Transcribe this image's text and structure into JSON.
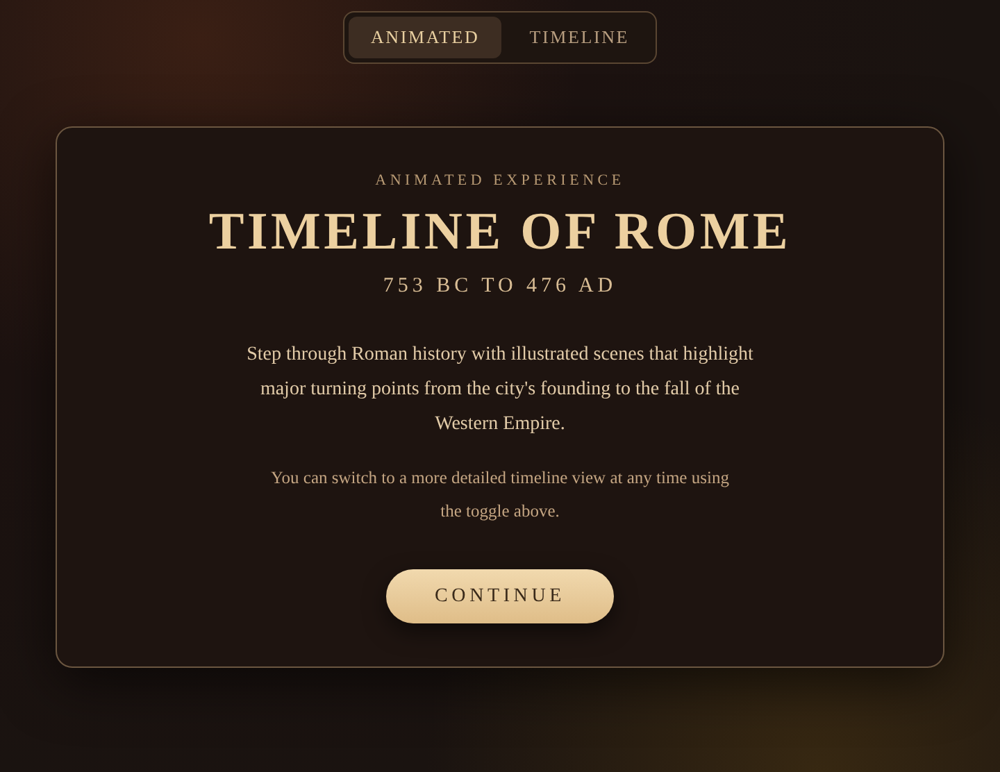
{
  "tabs": [
    {
      "label": "ANIMATED",
      "selected": true
    },
    {
      "label": "TIMELINE",
      "selected": false
    }
  ],
  "card": {
    "eyebrow": "ANIMATED EXPERIENCE",
    "title": "TIMELINE OF ROME",
    "subtitle": "753 BC TO 476 AD",
    "description": "Step through Roman history with illustrated scenes that highlight major turning points from the city's founding to the fall of the Western Empire.",
    "note": "You can switch to a more detailed timeline view at any time using the toggle above.",
    "button": "CONTINUE"
  }
}
